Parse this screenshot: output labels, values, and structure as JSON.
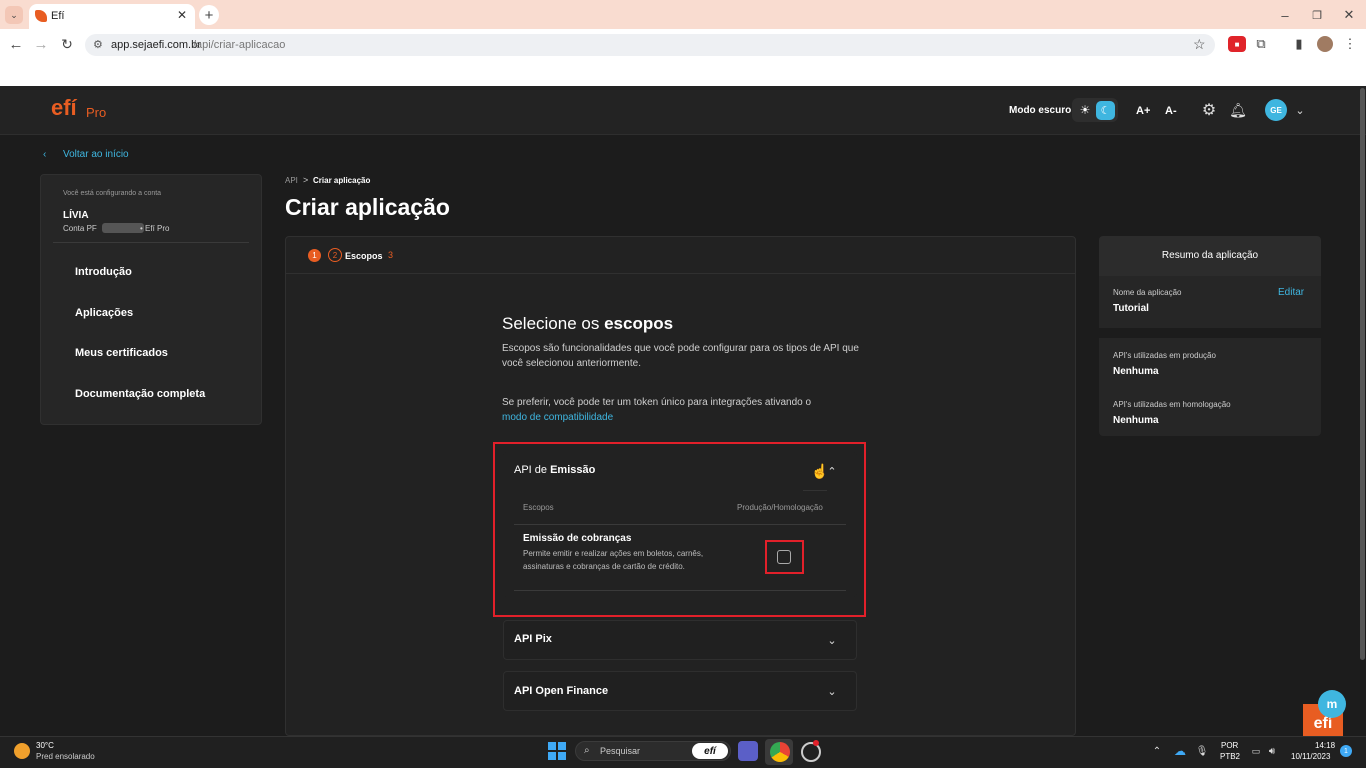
{
  "browser": {
    "tab_title": "Efí",
    "url_domain": "app.sejaefi.com.br",
    "url_path": "/api/criar-aplicacao"
  },
  "header": {
    "logo": "efí",
    "logo_suffix": "Pro",
    "dark_mode_label": "Modo escuro",
    "font_increase": "A+",
    "font_decrease": "A-",
    "avatar_initials": "GE"
  },
  "back_link": "Voltar ao início",
  "account": {
    "configuring_label": "Você está configurando a conta",
    "name": "LÍVIA",
    "account_line_prefix": "Conta PF",
    "account_line_suffix": "• Efí Pro"
  },
  "sidebar": {
    "items": [
      {
        "label": "Introdução"
      },
      {
        "label": "Aplicações"
      },
      {
        "label": "Meus certificados"
      },
      {
        "label": "Documentação completa"
      }
    ]
  },
  "breadcrumb": {
    "root": "API",
    "separator": ">",
    "current": "Criar aplicação"
  },
  "page_title": "Criar aplicação",
  "stepper": {
    "step1": "1",
    "step2": "2",
    "step2_label": "Escopos",
    "step3": "3"
  },
  "scopes": {
    "heading_prefix": "Selecione os",
    "heading_bold": "escopos",
    "description": "Escopos são funcionalidades que você pode configurar para os tipos de API que você selecionou anteriormente.",
    "token_text": "Se preferir, você pode ter um token único para integrações ativando o",
    "compat_link": "modo de compatibilidade"
  },
  "api_emissao": {
    "title_prefix": "API de",
    "title_bold": "Emissão",
    "col_scopes": "Escopos",
    "col_env": "Produção/Homologação",
    "row_title": "Emissão de cobranças",
    "row_desc": "Permite emitir e realizar ações em boletos, carnês, assinaturas e cobranças de cartão de crédito.",
    "checked": false
  },
  "api_pix": {
    "title": "API Pix"
  },
  "api_open_finance": {
    "title": "API Open Finance"
  },
  "summary": {
    "title": "Resumo da aplicação",
    "name_label": "Nome da aplicação",
    "edit": "Editar",
    "name_value": "Tutorial",
    "prod_label": "API's utilizadas em produção",
    "prod_value": "Nenhuma",
    "homolog_label": "API's utilizadas em homologação",
    "homolog_value": "Nenhuma"
  },
  "taskbar": {
    "temperature": "30°C",
    "weather": "Pred ensolarado",
    "search_placeholder": "Pesquisar",
    "search_brand": "efí",
    "lang": "POR",
    "layout": "PTB2",
    "time": "14:18",
    "date": "10/11/2023",
    "notifications": "1"
  },
  "watermark": "efí",
  "colors": {
    "accent_orange": "#e85d22",
    "link_blue": "#3fb6e0",
    "highlight_red": "#e2202a"
  }
}
